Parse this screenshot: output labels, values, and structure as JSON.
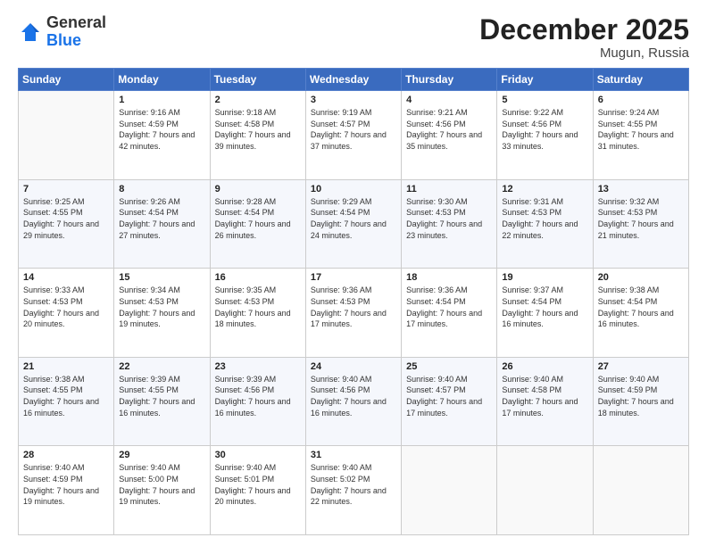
{
  "logo": {
    "general": "General",
    "blue": "Blue"
  },
  "header": {
    "month": "December 2025",
    "location": "Mugun, Russia"
  },
  "weekdays": [
    "Sunday",
    "Monday",
    "Tuesday",
    "Wednesday",
    "Thursday",
    "Friday",
    "Saturday"
  ],
  "weeks": [
    [
      {
        "day": "",
        "sunrise": "",
        "sunset": "",
        "daylight": "",
        "empty": true
      },
      {
        "day": "1",
        "sunrise": "Sunrise: 9:16 AM",
        "sunset": "Sunset: 4:59 PM",
        "daylight": "Daylight: 7 hours and 42 minutes."
      },
      {
        "day": "2",
        "sunrise": "Sunrise: 9:18 AM",
        "sunset": "Sunset: 4:58 PM",
        "daylight": "Daylight: 7 hours and 39 minutes."
      },
      {
        "day": "3",
        "sunrise": "Sunrise: 9:19 AM",
        "sunset": "Sunset: 4:57 PM",
        "daylight": "Daylight: 7 hours and 37 minutes."
      },
      {
        "day": "4",
        "sunrise": "Sunrise: 9:21 AM",
        "sunset": "Sunset: 4:56 PM",
        "daylight": "Daylight: 7 hours and 35 minutes."
      },
      {
        "day": "5",
        "sunrise": "Sunrise: 9:22 AM",
        "sunset": "Sunset: 4:56 PM",
        "daylight": "Daylight: 7 hours and 33 minutes."
      },
      {
        "day": "6",
        "sunrise": "Sunrise: 9:24 AM",
        "sunset": "Sunset: 4:55 PM",
        "daylight": "Daylight: 7 hours and 31 minutes."
      }
    ],
    [
      {
        "day": "7",
        "sunrise": "Sunrise: 9:25 AM",
        "sunset": "Sunset: 4:55 PM",
        "daylight": "Daylight: 7 hours and 29 minutes."
      },
      {
        "day": "8",
        "sunrise": "Sunrise: 9:26 AM",
        "sunset": "Sunset: 4:54 PM",
        "daylight": "Daylight: 7 hours and 27 minutes."
      },
      {
        "day": "9",
        "sunrise": "Sunrise: 9:28 AM",
        "sunset": "Sunset: 4:54 PM",
        "daylight": "Daylight: 7 hours and 26 minutes."
      },
      {
        "day": "10",
        "sunrise": "Sunrise: 9:29 AM",
        "sunset": "Sunset: 4:54 PM",
        "daylight": "Daylight: 7 hours and 24 minutes."
      },
      {
        "day": "11",
        "sunrise": "Sunrise: 9:30 AM",
        "sunset": "Sunset: 4:53 PM",
        "daylight": "Daylight: 7 hours and 23 minutes."
      },
      {
        "day": "12",
        "sunrise": "Sunrise: 9:31 AM",
        "sunset": "Sunset: 4:53 PM",
        "daylight": "Daylight: 7 hours and 22 minutes."
      },
      {
        "day": "13",
        "sunrise": "Sunrise: 9:32 AM",
        "sunset": "Sunset: 4:53 PM",
        "daylight": "Daylight: 7 hours and 21 minutes."
      }
    ],
    [
      {
        "day": "14",
        "sunrise": "Sunrise: 9:33 AM",
        "sunset": "Sunset: 4:53 PM",
        "daylight": "Daylight: 7 hours and 20 minutes."
      },
      {
        "day": "15",
        "sunrise": "Sunrise: 9:34 AM",
        "sunset": "Sunset: 4:53 PM",
        "daylight": "Daylight: 7 hours and 19 minutes."
      },
      {
        "day": "16",
        "sunrise": "Sunrise: 9:35 AM",
        "sunset": "Sunset: 4:53 PM",
        "daylight": "Daylight: 7 hours and 18 minutes."
      },
      {
        "day": "17",
        "sunrise": "Sunrise: 9:36 AM",
        "sunset": "Sunset: 4:53 PM",
        "daylight": "Daylight: 7 hours and 17 minutes."
      },
      {
        "day": "18",
        "sunrise": "Sunrise: 9:36 AM",
        "sunset": "Sunset: 4:54 PM",
        "daylight": "Daylight: 7 hours and 17 minutes."
      },
      {
        "day": "19",
        "sunrise": "Sunrise: 9:37 AM",
        "sunset": "Sunset: 4:54 PM",
        "daylight": "Daylight: 7 hours and 16 minutes."
      },
      {
        "day": "20",
        "sunrise": "Sunrise: 9:38 AM",
        "sunset": "Sunset: 4:54 PM",
        "daylight": "Daylight: 7 hours and 16 minutes."
      }
    ],
    [
      {
        "day": "21",
        "sunrise": "Sunrise: 9:38 AM",
        "sunset": "Sunset: 4:55 PM",
        "daylight": "Daylight: 7 hours and 16 minutes."
      },
      {
        "day": "22",
        "sunrise": "Sunrise: 9:39 AM",
        "sunset": "Sunset: 4:55 PM",
        "daylight": "Daylight: 7 hours and 16 minutes."
      },
      {
        "day": "23",
        "sunrise": "Sunrise: 9:39 AM",
        "sunset": "Sunset: 4:56 PM",
        "daylight": "Daylight: 7 hours and 16 minutes."
      },
      {
        "day": "24",
        "sunrise": "Sunrise: 9:40 AM",
        "sunset": "Sunset: 4:56 PM",
        "daylight": "Daylight: 7 hours and 16 minutes."
      },
      {
        "day": "25",
        "sunrise": "Sunrise: 9:40 AM",
        "sunset": "Sunset: 4:57 PM",
        "daylight": "Daylight: 7 hours and 17 minutes."
      },
      {
        "day": "26",
        "sunrise": "Sunrise: 9:40 AM",
        "sunset": "Sunset: 4:58 PM",
        "daylight": "Daylight: 7 hours and 17 minutes."
      },
      {
        "day": "27",
        "sunrise": "Sunrise: 9:40 AM",
        "sunset": "Sunset: 4:59 PM",
        "daylight": "Daylight: 7 hours and 18 minutes."
      }
    ],
    [
      {
        "day": "28",
        "sunrise": "Sunrise: 9:40 AM",
        "sunset": "Sunset: 4:59 PM",
        "daylight": "Daylight: 7 hours and 19 minutes."
      },
      {
        "day": "29",
        "sunrise": "Sunrise: 9:40 AM",
        "sunset": "Sunset: 5:00 PM",
        "daylight": "Daylight: 7 hours and 19 minutes."
      },
      {
        "day": "30",
        "sunrise": "Sunrise: 9:40 AM",
        "sunset": "Sunset: 5:01 PM",
        "daylight": "Daylight: 7 hours and 20 minutes."
      },
      {
        "day": "31",
        "sunrise": "Sunrise: 9:40 AM",
        "sunset": "Sunset: 5:02 PM",
        "daylight": "Daylight: 7 hours and 22 minutes."
      },
      {
        "day": "",
        "sunrise": "",
        "sunset": "",
        "daylight": "",
        "empty": true
      },
      {
        "day": "",
        "sunrise": "",
        "sunset": "",
        "daylight": "",
        "empty": true
      },
      {
        "day": "",
        "sunrise": "",
        "sunset": "",
        "daylight": "",
        "empty": true
      }
    ]
  ]
}
